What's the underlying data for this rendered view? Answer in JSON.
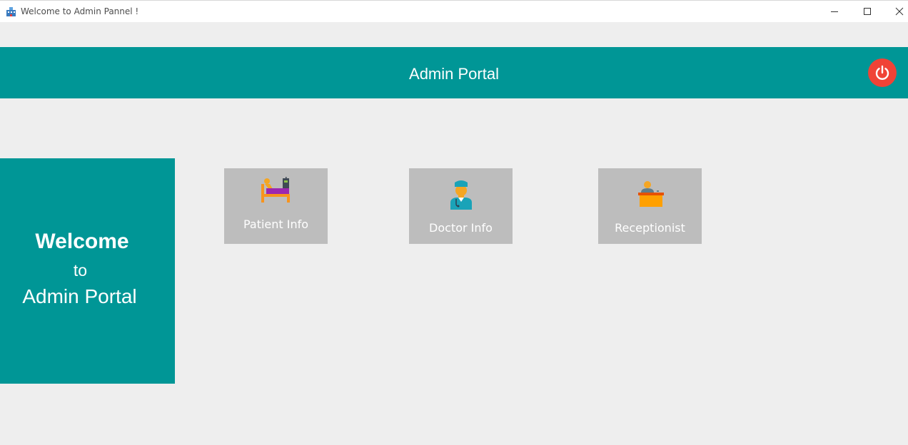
{
  "window": {
    "title": "Welcome to Admin Pannel !",
    "icons": {
      "app": "app-icon",
      "minimize": "minimize-icon",
      "maximize": "maximize-icon",
      "close": "close-icon"
    }
  },
  "header": {
    "title": "Admin Portal",
    "logout_icon": "power-icon"
  },
  "welcome": {
    "line1": "Welcome",
    "line2": "to",
    "line3": "Admin Portal"
  },
  "tiles": [
    {
      "label": "Patient Info",
      "icon": "patient-bed-icon"
    },
    {
      "label": "Doctor Info",
      "icon": "doctor-icon"
    },
    {
      "label": "Receptionist",
      "icon": "receptionist-icon"
    }
  ],
  "colors": {
    "primary": "#009696",
    "tile": "#bdbdbd",
    "power": "#f04336",
    "background": "#eeeeee"
  }
}
